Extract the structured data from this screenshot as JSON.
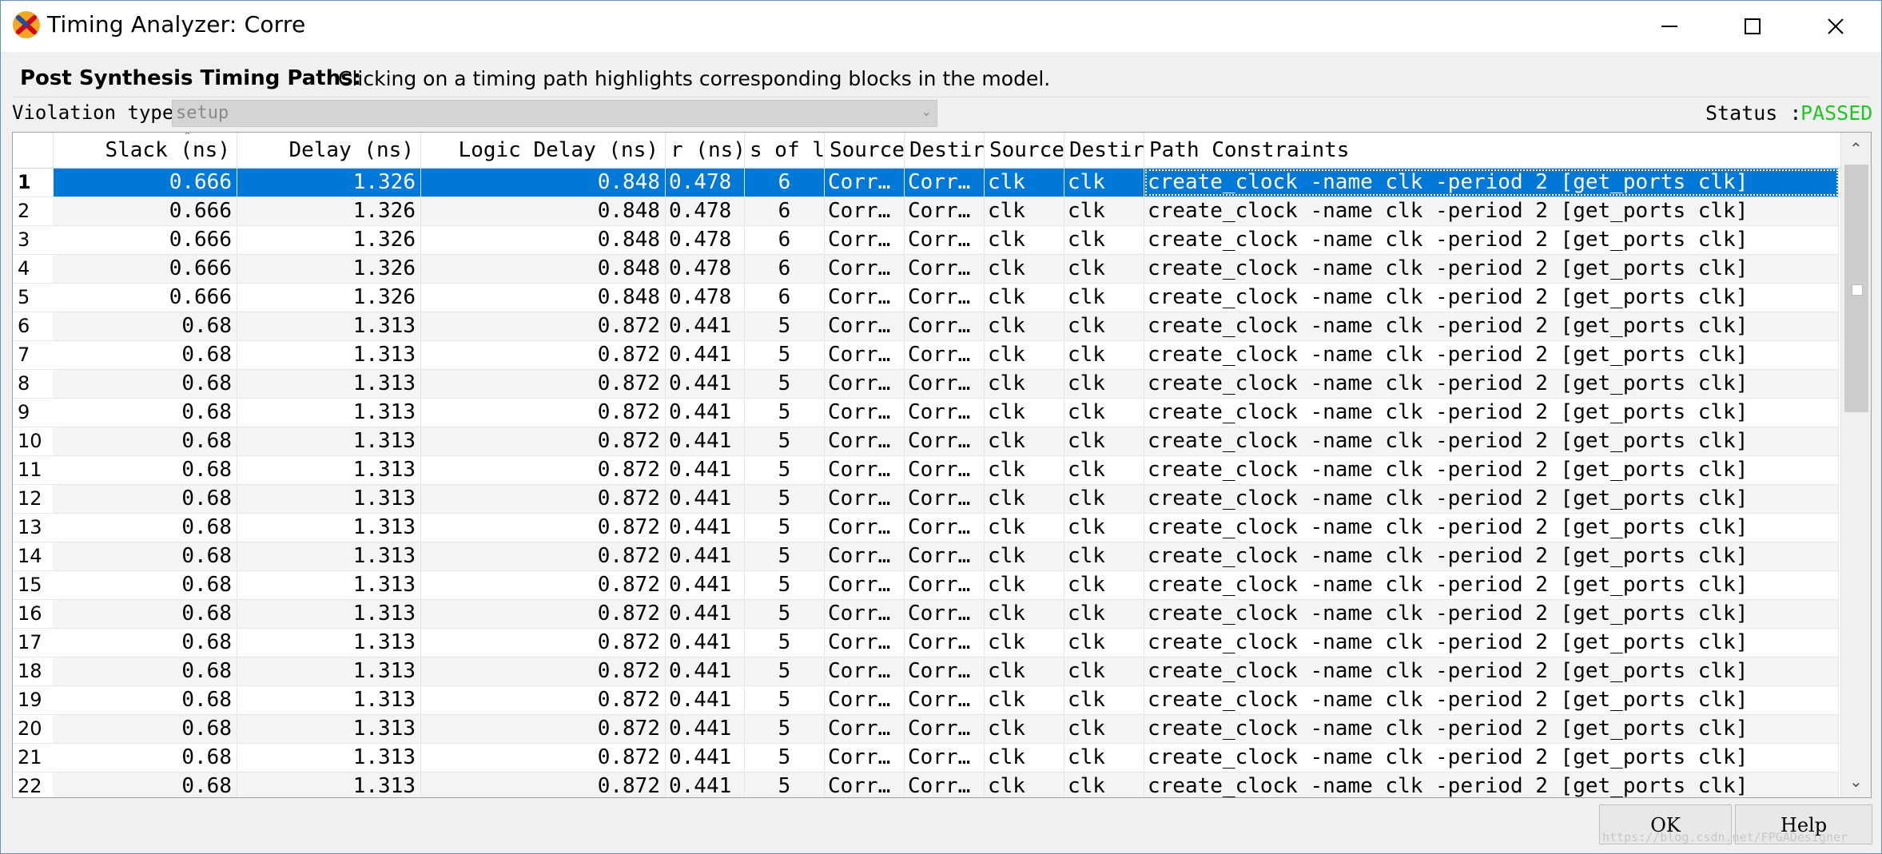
{
  "window": {
    "title": "Timing Analyzer: Corre"
  },
  "header": {
    "title": "Post Synthesis Timing Paths:",
    "description": "Clicking on a timing path highlights corresponding blocks in the model."
  },
  "filter": {
    "violation_label": "Violation type",
    "violation_value": "setup",
    "status_label": "Status :",
    "status_value": "PASSED"
  },
  "colors": {
    "selection": "#0078d7",
    "passed": "#1ec81e"
  },
  "table": {
    "columns": [
      "Slack (ns)",
      "Delay (ns)",
      "Logic Delay (ns)",
      "r (ns)",
      "s of l",
      "Source",
      "Destir",
      "Source",
      "Destir",
      "Path Constraints"
    ],
    "selected_row": 0,
    "rows": [
      {
        "n": "1",
        "slack": "0.666",
        "delay": "1.326",
        "logic": "0.848",
        "route": "0.478",
        "levels": "6",
        "src": "Corr…",
        "dst": "Corr…",
        "srcclk": "clk",
        "dstclk": "clk",
        "pc": "create_clock -name clk -period 2 [get_ports clk]"
      },
      {
        "n": "2",
        "slack": "0.666",
        "delay": "1.326",
        "logic": "0.848",
        "route": "0.478",
        "levels": "6",
        "src": "Corr…",
        "dst": "Corr…",
        "srcclk": "clk",
        "dstclk": "clk",
        "pc": "create_clock -name clk -period 2 [get_ports clk]"
      },
      {
        "n": "3",
        "slack": "0.666",
        "delay": "1.326",
        "logic": "0.848",
        "route": "0.478",
        "levels": "6",
        "src": "Corr…",
        "dst": "Corr…",
        "srcclk": "clk",
        "dstclk": "clk",
        "pc": "create_clock -name clk -period 2 [get_ports clk]"
      },
      {
        "n": "4",
        "slack": "0.666",
        "delay": "1.326",
        "logic": "0.848",
        "route": "0.478",
        "levels": "6",
        "src": "Corr…",
        "dst": "Corr…",
        "srcclk": "clk",
        "dstclk": "clk",
        "pc": "create_clock -name clk -period 2 [get_ports clk]"
      },
      {
        "n": "5",
        "slack": "0.666",
        "delay": "1.326",
        "logic": "0.848",
        "route": "0.478",
        "levels": "6",
        "src": "Corr…",
        "dst": "Corr…",
        "srcclk": "clk",
        "dstclk": "clk",
        "pc": "create_clock -name clk -period 2 [get_ports clk]"
      },
      {
        "n": "6",
        "slack": "0.68",
        "delay": "1.313",
        "logic": "0.872",
        "route": "0.441",
        "levels": "5",
        "src": "Corr…",
        "dst": "Corr…",
        "srcclk": "clk",
        "dstclk": "clk",
        "pc": "create_clock -name clk -period 2 [get_ports clk]"
      },
      {
        "n": "7",
        "slack": "0.68",
        "delay": "1.313",
        "logic": "0.872",
        "route": "0.441",
        "levels": "5",
        "src": "Corr…",
        "dst": "Corr…",
        "srcclk": "clk",
        "dstclk": "clk",
        "pc": "create_clock -name clk -period 2 [get_ports clk]"
      },
      {
        "n": "8",
        "slack": "0.68",
        "delay": "1.313",
        "logic": "0.872",
        "route": "0.441",
        "levels": "5",
        "src": "Corr…",
        "dst": "Corr…",
        "srcclk": "clk",
        "dstclk": "clk",
        "pc": "create_clock -name clk -period 2 [get_ports clk]"
      },
      {
        "n": "9",
        "slack": "0.68",
        "delay": "1.313",
        "logic": "0.872",
        "route": "0.441",
        "levels": "5",
        "src": "Corr…",
        "dst": "Corr…",
        "srcclk": "clk",
        "dstclk": "clk",
        "pc": "create_clock -name clk -period 2 [get_ports clk]"
      },
      {
        "n": "10",
        "slack": "0.68",
        "delay": "1.313",
        "logic": "0.872",
        "route": "0.441",
        "levels": "5",
        "src": "Corr…",
        "dst": "Corr…",
        "srcclk": "clk",
        "dstclk": "clk",
        "pc": "create_clock -name clk -period 2 [get_ports clk]"
      },
      {
        "n": "11",
        "slack": "0.68",
        "delay": "1.313",
        "logic": "0.872",
        "route": "0.441",
        "levels": "5",
        "src": "Corr…",
        "dst": "Corr…",
        "srcclk": "clk",
        "dstclk": "clk",
        "pc": "create_clock -name clk -period 2 [get_ports clk]"
      },
      {
        "n": "12",
        "slack": "0.68",
        "delay": "1.313",
        "logic": "0.872",
        "route": "0.441",
        "levels": "5",
        "src": "Corr…",
        "dst": "Corr…",
        "srcclk": "clk",
        "dstclk": "clk",
        "pc": "create_clock -name clk -period 2 [get_ports clk]"
      },
      {
        "n": "13",
        "slack": "0.68",
        "delay": "1.313",
        "logic": "0.872",
        "route": "0.441",
        "levels": "5",
        "src": "Corr…",
        "dst": "Corr…",
        "srcclk": "clk",
        "dstclk": "clk",
        "pc": "create_clock -name clk -period 2 [get_ports clk]"
      },
      {
        "n": "14",
        "slack": "0.68",
        "delay": "1.313",
        "logic": "0.872",
        "route": "0.441",
        "levels": "5",
        "src": "Corr…",
        "dst": "Corr…",
        "srcclk": "clk",
        "dstclk": "clk",
        "pc": "create_clock -name clk -period 2 [get_ports clk]"
      },
      {
        "n": "15",
        "slack": "0.68",
        "delay": "1.313",
        "logic": "0.872",
        "route": "0.441",
        "levels": "5",
        "src": "Corr…",
        "dst": "Corr…",
        "srcclk": "clk",
        "dstclk": "clk",
        "pc": "create_clock -name clk -period 2 [get_ports clk]"
      },
      {
        "n": "16",
        "slack": "0.68",
        "delay": "1.313",
        "logic": "0.872",
        "route": "0.441",
        "levels": "5",
        "src": "Corr…",
        "dst": "Corr…",
        "srcclk": "clk",
        "dstclk": "clk",
        "pc": "create_clock -name clk -period 2 [get_ports clk]"
      },
      {
        "n": "17",
        "slack": "0.68",
        "delay": "1.313",
        "logic": "0.872",
        "route": "0.441",
        "levels": "5",
        "src": "Corr…",
        "dst": "Corr…",
        "srcclk": "clk",
        "dstclk": "clk",
        "pc": "create_clock -name clk -period 2 [get_ports clk]"
      },
      {
        "n": "18",
        "slack": "0.68",
        "delay": "1.313",
        "logic": "0.872",
        "route": "0.441",
        "levels": "5",
        "src": "Corr…",
        "dst": "Corr…",
        "srcclk": "clk",
        "dstclk": "clk",
        "pc": "create_clock -name clk -period 2 [get_ports clk]"
      },
      {
        "n": "19",
        "slack": "0.68",
        "delay": "1.313",
        "logic": "0.872",
        "route": "0.441",
        "levels": "5",
        "src": "Corr…",
        "dst": "Corr…",
        "srcclk": "clk",
        "dstclk": "clk",
        "pc": "create_clock -name clk -period 2 [get_ports clk]"
      },
      {
        "n": "20",
        "slack": "0.68",
        "delay": "1.313",
        "logic": "0.872",
        "route": "0.441",
        "levels": "5",
        "src": "Corr…",
        "dst": "Corr…",
        "srcclk": "clk",
        "dstclk": "clk",
        "pc": "create_clock -name clk -period 2 [get_ports clk]"
      },
      {
        "n": "21",
        "slack": "0.68",
        "delay": "1.313",
        "logic": "0.872",
        "route": "0.441",
        "levels": "5",
        "src": "Corr…",
        "dst": "Corr…",
        "srcclk": "clk",
        "dstclk": "clk",
        "pc": "create_clock -name clk -period 2 [get_ports clk]"
      },
      {
        "n": "22",
        "slack": "0.68",
        "delay": "1.313",
        "logic": "0.872",
        "route": "0.441",
        "levels": "5",
        "src": "Corr…",
        "dst": "Corr…",
        "srcclk": "clk",
        "dstclk": "clk",
        "pc": "create_clock -name clk -period 2 [get_ports clk]"
      }
    ]
  },
  "footer": {
    "ok_label": "OK",
    "help_label": "Help",
    "watermark": "https://blog.csdn.net/FPGADesigner"
  }
}
